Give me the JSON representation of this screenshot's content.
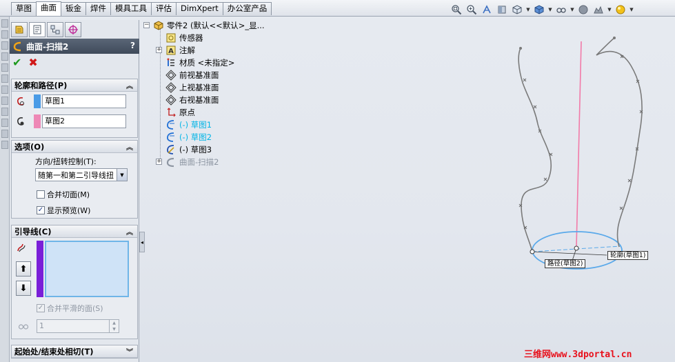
{
  "command_tabs": [
    "草图",
    "曲面",
    "钣金",
    "焊件",
    "模具工具",
    "评估",
    "DimXpert",
    "办公室产品"
  ],
  "active_tab_index": 1,
  "heads_up_icons": [
    "zoom-to-fit-icon",
    "zoom-area-icon",
    "previous-view-icon",
    "section-view-icon",
    "view-orientation-icon",
    "display-style-icon",
    "hide-show-items-icon",
    "edit-appearance-icon",
    "apply-scene-icon",
    "view-settings-icon"
  ],
  "property_manager": {
    "title": "曲面-扫描2",
    "help": "?",
    "ok_symbol": "✔",
    "cancel_symbol": "✖",
    "profile_group": {
      "title": "轮廓和路径(P)",
      "profile_value": "草图1",
      "profile_color": "#4a9be6",
      "path_value": "草图2",
      "path_color": "#ee88b6"
    },
    "options_group": {
      "title": "选项(O)",
      "orient_label": "方向/扭转控制(T):",
      "orient_value": "随第一和第二引导线扭",
      "merge_tangent_label": "合并切面(M)",
      "merge_tangent_checked": false,
      "show_preview_label": "显示预览(W)",
      "show_preview_checked": true
    },
    "guide_group": {
      "title": "引导线(C)",
      "guide_color": "#7a1fd8",
      "move_up": "⬆",
      "move_down": "⬇",
      "merge_smooth_label": "合并平滑的面(S)",
      "merge_smooth_checked": true,
      "count_value": "1"
    },
    "tangency_group": {
      "title": "起始处/结束处相切(T)"
    }
  },
  "feature_tree": {
    "root": "零件2  (默认<<默认>_显...",
    "items": [
      {
        "label": "传感器",
        "style": "normal"
      },
      {
        "label": "注解",
        "style": "normal"
      },
      {
        "label": "材质 <未指定>",
        "style": "normal"
      },
      {
        "label": "前视基准面",
        "style": "normal"
      },
      {
        "label": "上视基准面",
        "style": "normal"
      },
      {
        "label": "右视基准面",
        "style": "normal"
      },
      {
        "label": "原点",
        "style": "normal"
      },
      {
        "label": "(-) 草图1",
        "style": "cyan"
      },
      {
        "label": "(-) 草图2",
        "style": "cyan"
      },
      {
        "label": "(-) 草图3",
        "style": "normal"
      },
      {
        "label": "曲面-扫描2",
        "style": "grey"
      }
    ]
  },
  "viewport": {
    "profile_callout": "轮廓(草图1)",
    "path_callout": "路径(草图2)",
    "path_line_color": "#f27aa8",
    "profile_ellipse_color": "#5aa9ea",
    "guide_curve_color": "#7a7a7a"
  },
  "watermark": "三维网www.3dportal.cn"
}
